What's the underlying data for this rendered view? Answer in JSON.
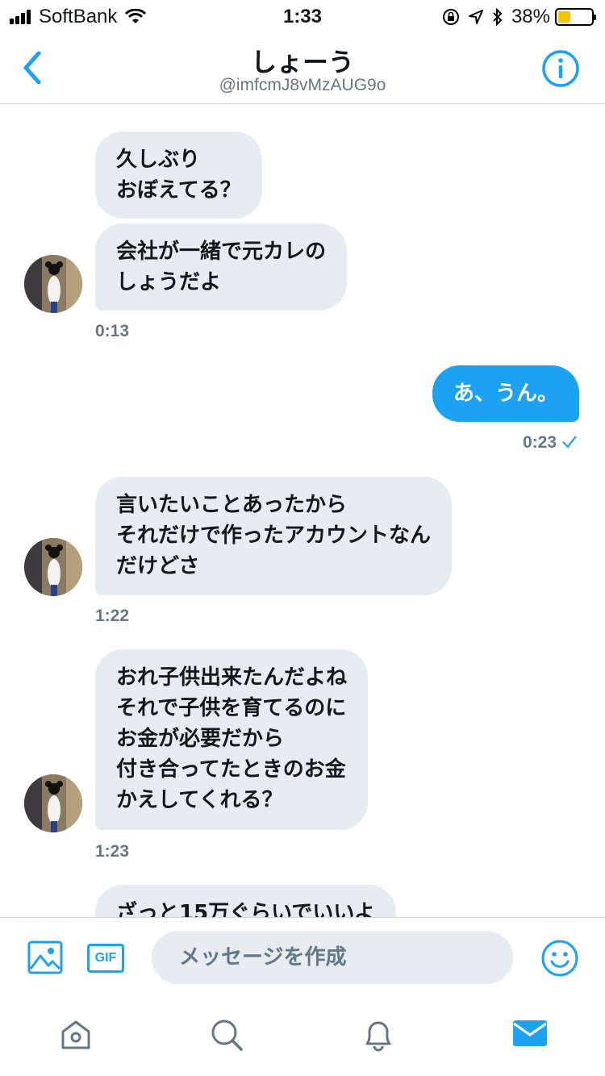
{
  "status_bar": {
    "carrier": "SoftBank",
    "time": "1:33",
    "battery_percent": "38%",
    "battery_level": 0.38,
    "icons": [
      "signal-icon",
      "wifi-icon",
      "orientation-lock-icon",
      "location-icon",
      "bluetooth-icon",
      "battery-icon"
    ]
  },
  "header": {
    "title": "しょーう",
    "handle": "@imfcmJ8vMzAUG9o",
    "back_icon": "chevron-left-icon",
    "info_icon": "info-icon"
  },
  "messages": [
    {
      "side": "them",
      "text": "久しぶり\nおぼえてる？"
    },
    {
      "side": "them",
      "text": "会社が一緒で元カレの\nしょうだよ",
      "time": "0:13"
    },
    {
      "side": "me",
      "text": "あ、うん。",
      "time": "0:23"
    },
    {
      "side": "them",
      "text": "言いたいことあったから\nそれだけで作ったアカウントなん\nだけどさ",
      "time": "1:22"
    },
    {
      "side": "them",
      "text": "おれ子供出来たんだよね\nそれで子供を育てるのに\nお金が必要だから\n付き合ってたときのお金\nかえしてくれる？",
      "time": "1:23"
    },
    {
      "side": "them",
      "text": "ざっと15万ぐらいでいいよ"
    }
  ],
  "composer": {
    "placeholder": "メッセージを作成",
    "gif_label": "GIF",
    "icons": [
      "image-icon",
      "gif-icon",
      "emoji-icon"
    ]
  },
  "tabbar": {
    "tabs": [
      "home-icon",
      "search-icon",
      "notifications-icon",
      "messages-icon"
    ],
    "active": "messages-icon"
  },
  "colors": {
    "accent": "#1da1f2",
    "bubble_them": "#e6ecf0",
    "muted": "#657786",
    "battery": "#f5c400"
  }
}
